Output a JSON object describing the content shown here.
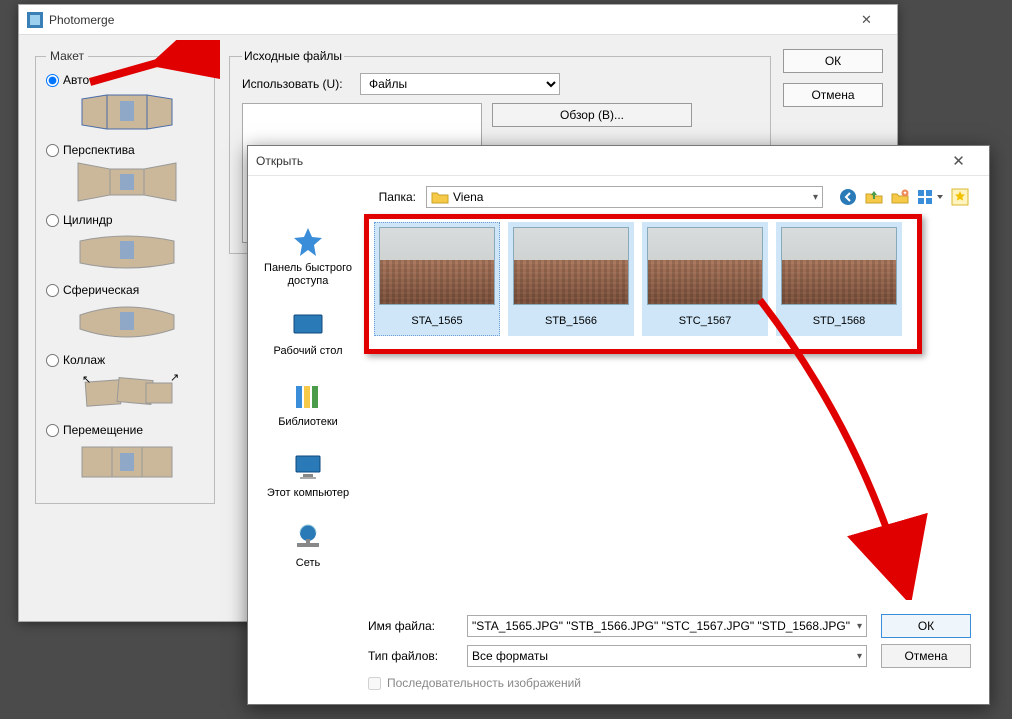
{
  "photomerge": {
    "title": "Photomerge",
    "layout_legend": "Макет",
    "options": {
      "auto": "Авто",
      "perspective": "Перспектива",
      "cylinder": "Цилиндр",
      "spherical": "Сферическая",
      "collage": "Коллаж",
      "reposition": "Перемещение"
    },
    "src_legend": "Исходные файлы",
    "use_label": "Использовать (U):",
    "use_value": "Файлы",
    "browse": "Обзор (B)...",
    "ok": "ОК",
    "cancel": "Отмена"
  },
  "open": {
    "title": "Открыть",
    "folder_label": "Папка:",
    "folder_value": "Viena",
    "places": {
      "quick": "Панель быстрого доступа",
      "desktop": "Рабочий стол",
      "libraries": "Библиотеки",
      "computer": "Этот компьютер",
      "network": "Сеть"
    },
    "thumbs": [
      "STA_1565",
      "STB_1566",
      "STC_1567",
      "STD_1568"
    ],
    "filename_label": "Имя файла:",
    "filename_value": "\"STA_1565.JPG\" \"STB_1566.JPG\" \"STC_1567.JPG\" \"STD_1568.JPG\"",
    "filetype_label": "Тип файлов:",
    "filetype_value": "Все форматы",
    "ok": "ОК",
    "cancel": "Отмена",
    "sequence": "Последовательность изображений"
  }
}
